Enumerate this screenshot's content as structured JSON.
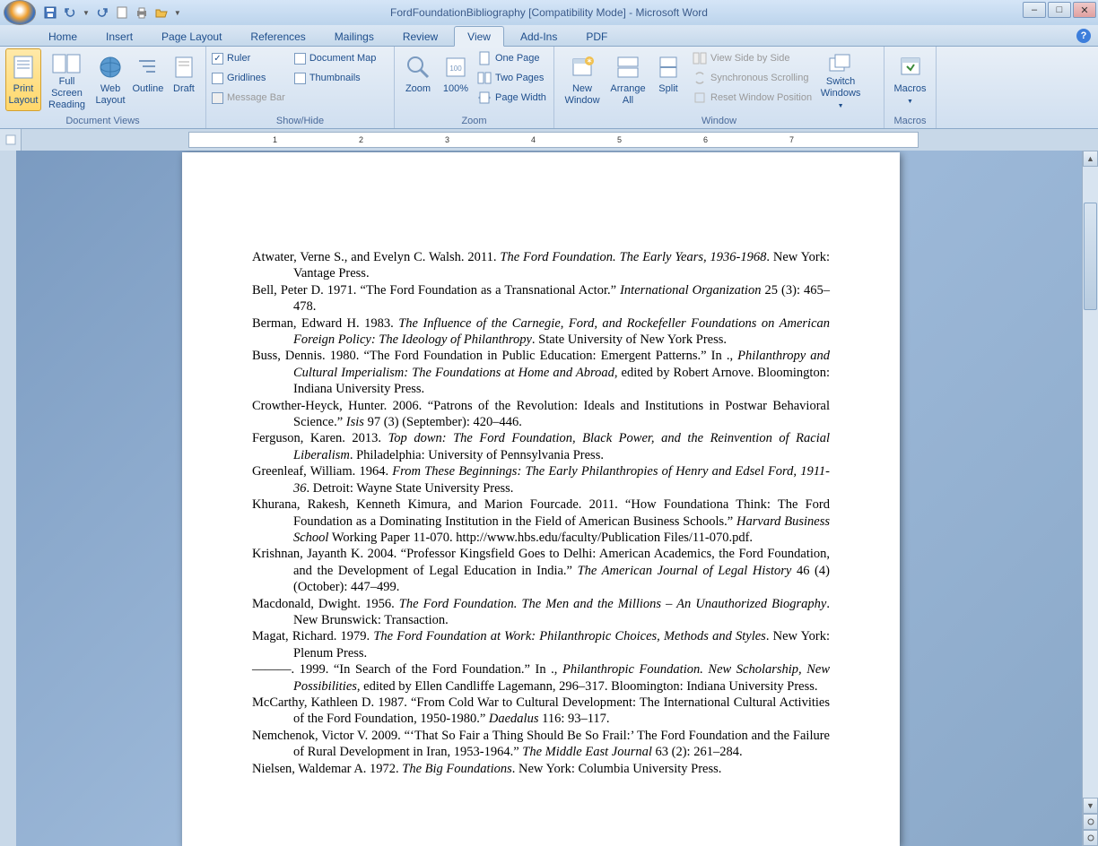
{
  "title": "FordFoundationBibliography [Compatibility Mode] - Microsoft Word",
  "tabs": {
    "home": "Home",
    "insert": "Insert",
    "page_layout": "Page Layout",
    "references": "References",
    "mailings": "Mailings",
    "review": "Review",
    "view": "View",
    "addins": "Add-Ins",
    "pdf": "PDF"
  },
  "ribbon": {
    "document_views": {
      "label": "Document Views",
      "print_layout": "Print Layout",
      "full_screen": "Full Screen Reading",
      "web_layout": "Web Layout",
      "outline": "Outline",
      "draft": "Draft"
    },
    "show_hide": {
      "label": "Show/Hide",
      "ruler": "Ruler",
      "gridlines": "Gridlines",
      "message_bar": "Message Bar",
      "document_map": "Document Map",
      "thumbnails": "Thumbnails"
    },
    "zoom": {
      "label": "Zoom",
      "zoom": "Zoom",
      "percent": "100%",
      "one_page": "One Page",
      "two_pages": "Two Pages",
      "page_width": "Page Width"
    },
    "window": {
      "label": "Window",
      "new_window": "New Window",
      "arrange_all": "Arrange All",
      "split": "Split",
      "side_by_side": "View Side by Side",
      "sync_scroll": "Synchronous Scrolling",
      "reset_pos": "Reset Window Position",
      "switch": "Switch Windows"
    },
    "macros": {
      "label": "Macros",
      "macros": "Macros"
    }
  },
  "ruler_marks": [
    "1",
    "2",
    "3",
    "4",
    "5",
    "6",
    "7"
  ],
  "entries": [
    {
      "pre": "Atwater, Verne S., and Evelyn C. Walsh. 2011. ",
      "it": "The Ford Foundation. The Early Years, 1936-1968",
      "post": ". New York: Vantage Press."
    },
    {
      "pre": "Bell, Peter D. 1971. “The Ford Foundation as a Transnational Actor.” ",
      "it": "International Organization",
      "post": " 25 (3): 465–478."
    },
    {
      "pre": "Berman, Edward H. 1983. ",
      "it": "The Influence of the Carnegie, Ford, and Rockefeller Foundations on American Foreign Policy: The Ideology of Philanthropy",
      "post": ". State University of New York Press."
    },
    {
      "pre": "Buss, Dennis. 1980. “The Ford Foundation in Public Education: Emergent Patterns.” In ., ",
      "it": "Philanthropy and Cultural Imperialism: The Foundations at Home and Abroad",
      "post": ", edited by Robert Arnove. Bloomington: Indiana University Press."
    },
    {
      "pre": "Crowther-Heyck, Hunter. 2006. “Patrons of the Revolution: Ideals and Institutions in Postwar Behavioral Science.” ",
      "it": "Isis",
      "post": " 97 (3) (September): 420–446."
    },
    {
      "pre": "Ferguson, Karen. 2013. ",
      "it": "Top down: The Ford Foundation, Black Power, and the Reinvention of Racial Liberalism",
      "post": ". Philadelphia: University of Pennsylvania Press."
    },
    {
      "pre": "Greenleaf, William. 1964. ",
      "it": "From These Beginnings: The Early Philanthropies of Henry and Edsel Ford, 1911-36",
      "post": ". Detroit: Wayne State University Press."
    },
    {
      "pre": "Khurana, Rakesh, Kenneth Kimura, and Marion Fourcade. 2011. “How Foundationa Think: The Ford Foundation as a Dominating Institution in the Field of American Business Schools.” ",
      "it": "Harvard Business School",
      "post": " Working Paper 11-070. http://www.hbs.edu/faculty/Publication Files/11-070.pdf."
    },
    {
      "pre": "Krishnan, Jayanth K. 2004. “Professor Kingsfield Goes to Delhi: American Academics, the Ford Foundation, and the Development of Legal Education in India.” ",
      "it": "The American Journal of Legal History",
      "post": " 46 (4) (October): 447–499."
    },
    {
      "pre": "Macdonald, Dwight. 1956. ",
      "it": "The Ford Foundation. The Men and the Millions – An Unauthorized Biography",
      "post": ". New Brunswick: Transaction."
    },
    {
      "pre": "Magat, Richard. 1979. ",
      "it": "The Ford Foundation at Work: Philanthropic Choices, Methods and Styles",
      "post": ". New York: Plenum Press."
    },
    {
      "pre": "———. 1999. “In Search of the Ford Foundation.” In ., ",
      "it": "Philanthropic Foundation. New Scholarship, New Possibilities",
      "post": ", edited by Ellen Candliffe Lagemann, 296–317. Bloomington: Indiana University Press."
    },
    {
      "pre": "McCarthy, Kathleen D. 1987. “From Cold War to Cultural Development: The International Cultural Activities of the Ford Foundation, 1950-1980.” ",
      "it": "Daedalus",
      "post": " 116: 93–117."
    },
    {
      "pre": "Nemchenok, Victor V. 2009. “‘That So Fair a Thing Should Be So Frail:’ The Ford Foundation and the Failure of Rural Development in Iran, 1953-1964.” ",
      "it": "The Middle East Journal",
      "post": " 63 (2): 261–284."
    },
    {
      "pre": "Nielsen, Waldemar A. 1972. ",
      "it": "The Big Foundations",
      "post": ". New York: Columbia University Press."
    }
  ]
}
